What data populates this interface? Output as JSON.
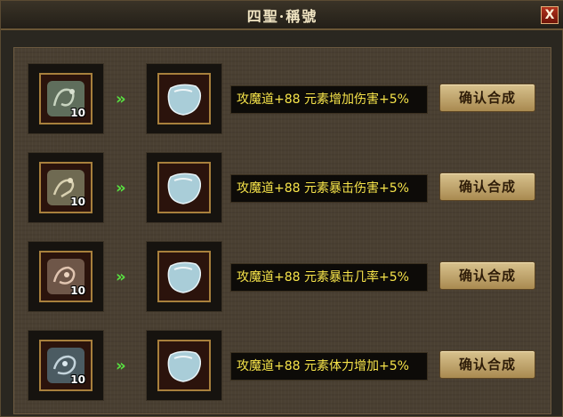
{
  "window": {
    "title": "四聖·稱號",
    "close_label": "X"
  },
  "rows": [
    {
      "source_count": "10",
      "source_color": "#5f6e5c",
      "arrow": "»",
      "result_color": "#a9cdd8",
      "description": "攻魔道+88 元素增加伤害+5%",
      "button_label": "确认合成"
    },
    {
      "source_count": "10",
      "source_color": "#6f6a52",
      "arrow": "»",
      "result_color": "#a9cdd8",
      "description": "攻魔道+88 元素暴击伤害+5%",
      "button_label": "确认合成"
    },
    {
      "source_count": "10",
      "source_color": "#6e5648",
      "arrow": "»",
      "result_color": "#a9cdd8",
      "description": "攻魔道+88 元素暴击几率+5%",
      "button_label": "确认合成"
    },
    {
      "source_count": "10",
      "source_color": "#4b5b62",
      "arrow": "»",
      "result_color": "#a9cdd8",
      "description": "攻魔道+88 元素体力增加+5%",
      "button_label": "确认合成"
    }
  ]
}
